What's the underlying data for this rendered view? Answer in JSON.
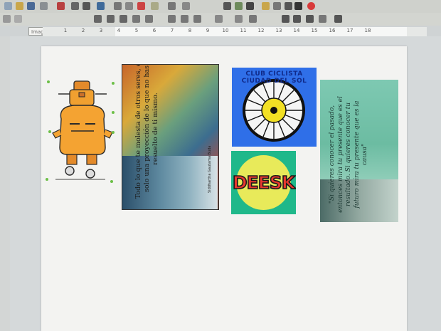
{
  "toolbar": {
    "style_combo_value": "Imagen",
    "icons": [
      "new-icon",
      "open-icon",
      "save-icon",
      "export-icon",
      "pdf-icon",
      "print-icon",
      "preview-icon",
      "spellcheck-icon",
      "cut-icon",
      "copy-icon",
      "paste-icon",
      "clone-icon",
      "undo-icon",
      "redo-icon",
      "table-icon",
      "image-icon",
      "chart-icon",
      "textbox-icon",
      "pagebreak-icon",
      "field-icon",
      "special-char-icon",
      "hyperlink-icon",
      "comment-icon",
      "track-changes-icon",
      "shapes-icon",
      "stop-icon"
    ]
  },
  "ruler": {
    "ticks": [
      "1",
      "2",
      "3",
      "4",
      "5",
      "6",
      "7",
      "8",
      "9",
      "10",
      "11",
      "12",
      "13",
      "14",
      "15",
      "16",
      "17",
      "18"
    ]
  },
  "document": {
    "images": [
      {
        "name": "robot-image",
        "selected": true
      },
      {
        "name": "buddha-quote-image",
        "text": "Todo lo que te molesta de otros seres, es solo una proyección de lo que no has resuelto de ti mismo.",
        "author": "Siddhartha Gautama Buda"
      },
      {
        "name": "club-logo-image",
        "text": "CLUB CICLISTA CIUDAD DEL SOL"
      },
      {
        "name": "deesk-logo-image",
        "text": "DEESK"
      },
      {
        "name": "past-future-quote-image",
        "text": "\"Si quieres conocer el pasado, entonces mira tu presente que es el resultado. Si quieres conocer tu futuro mira tu presente que es la causa\""
      }
    ]
  },
  "colors": {
    "page": "#f3f3f1",
    "workspace": "#d5d9da",
    "selection_handle": "#6cbf47",
    "club_bg": "#2f6fe8",
    "deesk_bg": "#1fb88a",
    "deesk_circle": "#e8ea5a",
    "deesk_text": "#e8382f"
  }
}
